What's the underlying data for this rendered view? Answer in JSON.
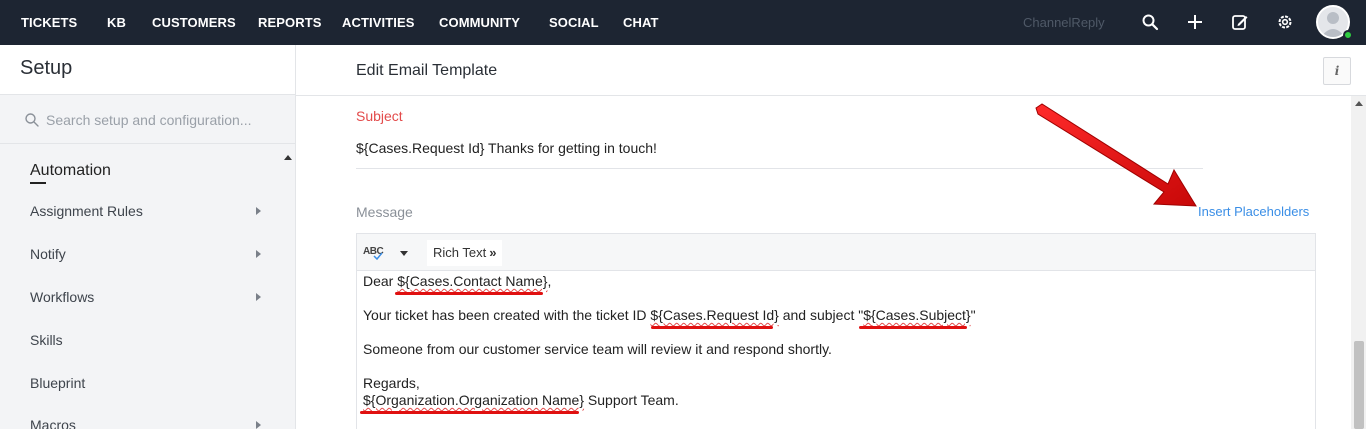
{
  "nav": {
    "items": [
      "TICKETS",
      "KB",
      "CUSTOMERS",
      "REPORTS",
      "ACTIVITIES",
      "COMMUNITY",
      "SOCIAL",
      "CHAT"
    ],
    "channel_reply": "ChannelReply",
    "icons": [
      "search-icon",
      "plus-icon",
      "compose-icon",
      "gear-icon"
    ]
  },
  "sidebar": {
    "title": "Setup",
    "search_placeholder": "Search setup and configuration...",
    "section": "Automation",
    "items": [
      {
        "label": "Assignment Rules",
        "has_submenu": true
      },
      {
        "label": "Notify",
        "has_submenu": true
      },
      {
        "label": "Workflows",
        "has_submenu": true
      },
      {
        "label": "Skills",
        "has_submenu": false
      },
      {
        "label": "Blueprint",
        "has_submenu": false
      },
      {
        "label": "Macros",
        "has_submenu": true
      }
    ]
  },
  "main": {
    "title": "Edit Email Template",
    "info_label": "i",
    "subject_label": "Subject",
    "subject_value": "${Cases.Request Id} Thanks for getting in touch!",
    "message_label": "Message",
    "insert_placeholders": "Insert Placeholders",
    "toolbar": {
      "spell_label": "ABC",
      "rich_text": "Rich Text",
      "rich_text_chevron": "»"
    },
    "body": {
      "line1_prefix": "Dear ",
      "line1_ph": "${Cases.Contact Name}",
      "line1_suffix": ",",
      "line2_prefix": "Your ticket has been created with the ticket ID  ",
      "line2_ph1": "${Cases.Request Id}",
      "line2_mid": " and subject  \"",
      "line2_ph2": "${Cases.Subject}",
      "line2_suffix": "\"",
      "line3": "Someone from our customer service team will review it and respond shortly.",
      "line4": "Regards,",
      "line5_ph": "${Organization.Organization Name}",
      "line5_suffix": " Support Team."
    }
  },
  "colors": {
    "nav_bg": "#1d2532",
    "accent_link": "#3a8ee6",
    "subject_label": "#e34b4b",
    "annotation_red": "#e01010"
  }
}
